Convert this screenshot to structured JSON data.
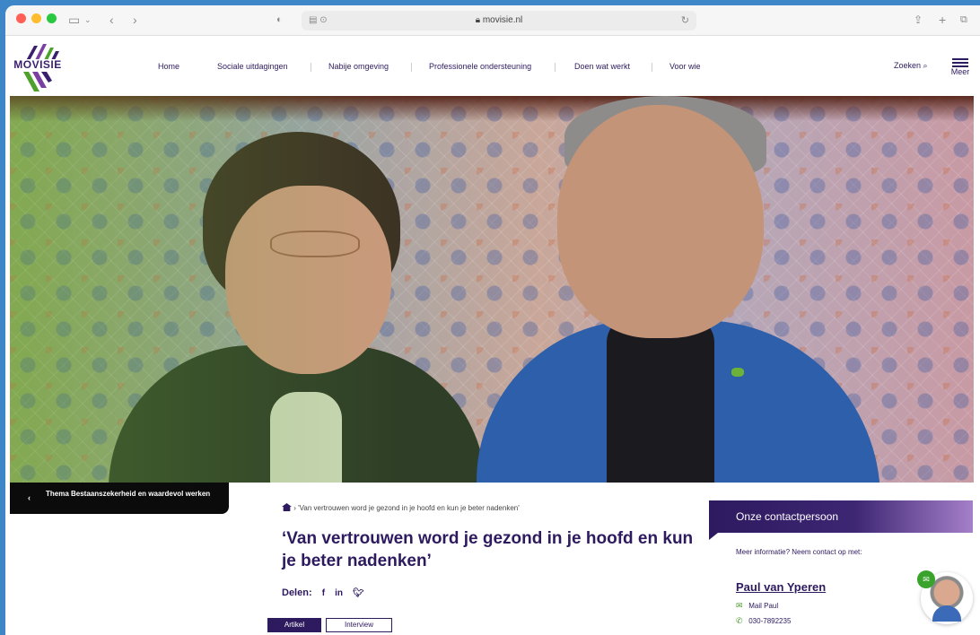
{
  "browser": {
    "url": "movisie.nl",
    "lock_icon": "lock-icon"
  },
  "header": {
    "logo_text": "MOVISIE",
    "nav": [
      "Home",
      "Sociale uitdagingen",
      "Nabije omgeving",
      "Professionele ondersteuning",
      "Doen wat werkt",
      "Voor wie"
    ],
    "search_label": "Zoeken",
    "menu_label": "Meer"
  },
  "back_chip": {
    "label": "Thema Bestaanszekerheid en waardevol werken"
  },
  "breadcrumb": {
    "current": "'Van vertrouwen word je gezond in je hoofd en kun je beter nadenken'"
  },
  "article": {
    "title": "‘Van vertrouwen word je gezond in je hoofd en kun je beter nadenken’",
    "share_label": "Delen:",
    "share_icons": [
      "f",
      "in",
      "❯"
    ],
    "tags": [
      "Artikel",
      "Interview"
    ]
  },
  "contact": {
    "heading": "Onze contactpersoon",
    "intro": "Meer informatie? Neem contact op met:",
    "name": "Paul van Yperen",
    "mail": "Mail Paul",
    "phone": "030-7892235"
  },
  "colors": {
    "brand": "#2d1a5f",
    "accent_green": "#3aa32b"
  }
}
